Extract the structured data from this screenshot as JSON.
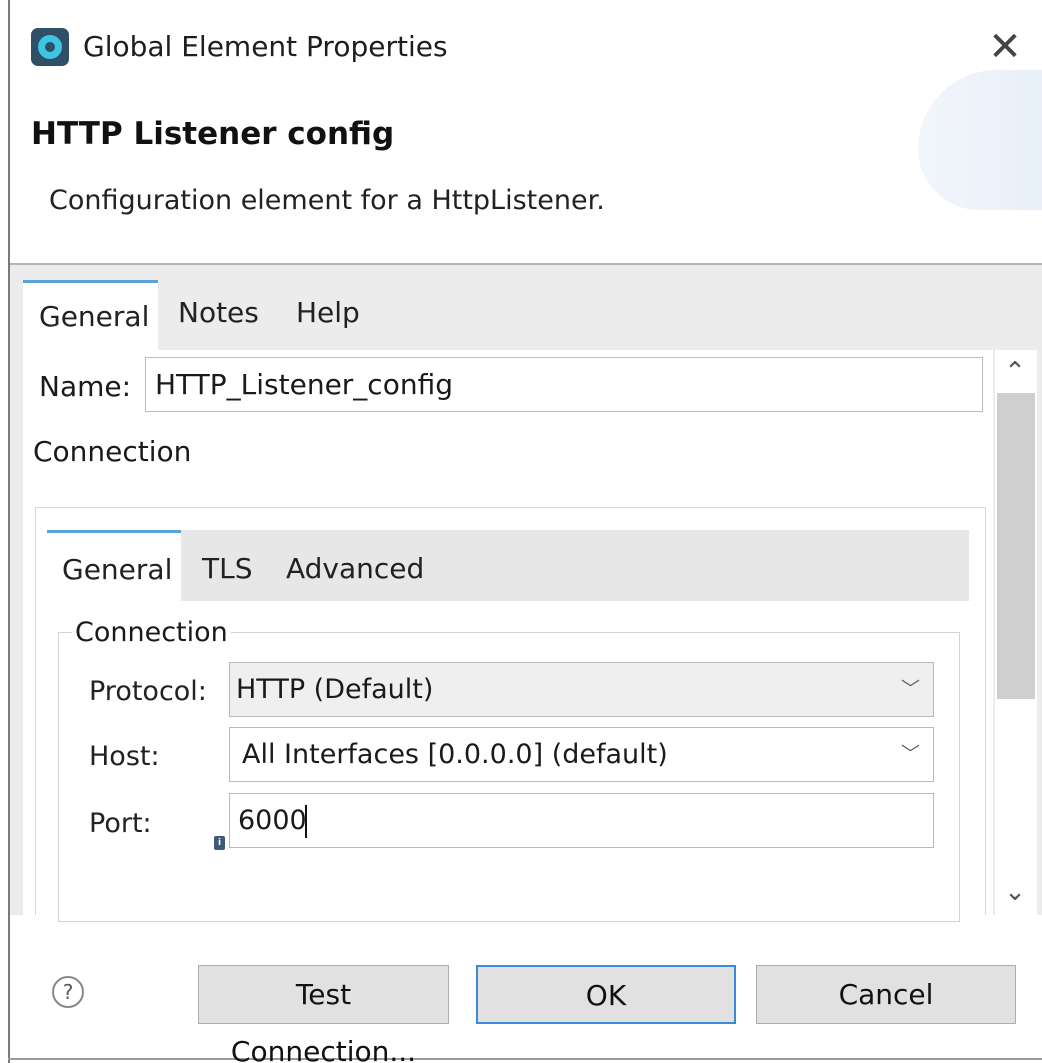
{
  "window": {
    "title": "Global Element Properties",
    "close_symbol": "✕",
    "app_icon": "mulesoft-studio-icon"
  },
  "header": {
    "title": "HTTP Listener config",
    "description": "Configuration element for a HttpListener."
  },
  "tabs": [
    {
      "label": "General",
      "active": true
    },
    {
      "label": "Notes",
      "active": false
    },
    {
      "label": "Help",
      "active": false
    }
  ],
  "general": {
    "name_label": "Name:",
    "name_value": "HTTP_Listener_config",
    "connection_heading": "Connection"
  },
  "connection_tabs": [
    {
      "label": "General",
      "active": true
    },
    {
      "label": "TLS",
      "active": false
    },
    {
      "label": "Advanced",
      "active": false
    }
  ],
  "connection_group": {
    "legend": "Connection",
    "protocol_label": "Protocol:",
    "protocol_value": "HTTP (Default)",
    "host_label": "Host:",
    "host_value": "All Interfaces [0.0.0.0] (default)",
    "port_label": "Port:",
    "port_value": "6000"
  },
  "footer": {
    "help_symbol": "?",
    "test_connection_label": "Test Connection...",
    "ok_label": "OK",
    "cancel_label": "Cancel"
  },
  "colors": {
    "active_tab_accent": "#5aa3d6",
    "ok_button_border": "#3a8ad6",
    "tab_bar_background": "#ececec"
  }
}
